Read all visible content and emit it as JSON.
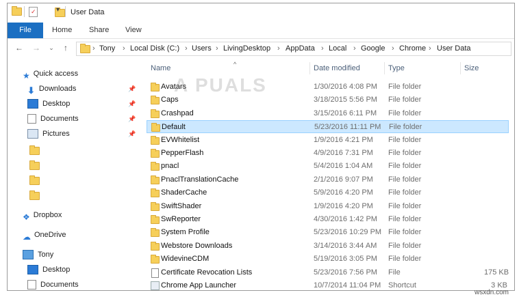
{
  "window": {
    "title": "User Data"
  },
  "ribbon": {
    "tabs": [
      "File",
      "Home",
      "Share",
      "View"
    ]
  },
  "address": {
    "crumbs": [
      "Tony",
      "Local Disk (C:)",
      "Users",
      "LivingDesktop",
      "AppData",
      "Local",
      "Google",
      "Chrome",
      "User Data"
    ]
  },
  "sidebar": {
    "quick_access": "Quick access",
    "pinned": [
      "Downloads",
      "Desktop",
      "Documents",
      "Pictures"
    ],
    "dropbox": "Dropbox",
    "onedrive": "OneDrive",
    "pc": "Tony",
    "pc_items": [
      "Desktop",
      "Documents"
    ]
  },
  "columns": {
    "name": "Name",
    "date": "Date modified",
    "type": "Type",
    "size": "Size"
  },
  "files": [
    {
      "name": "Avatars",
      "date": "1/30/2016 4:08 PM",
      "type": "File folder",
      "size": "",
      "icon": "folder"
    },
    {
      "name": "Caps",
      "date": "3/18/2015 5:56 PM",
      "type": "File folder",
      "size": "",
      "icon": "folder"
    },
    {
      "name": "Crashpad",
      "date": "3/15/2016 6:11 PM",
      "type": "File folder",
      "size": "",
      "icon": "folder"
    },
    {
      "name": "Default",
      "date": "5/23/2016 11:11 PM",
      "type": "File folder",
      "size": "",
      "icon": "folder"
    },
    {
      "name": "EVWhitelist",
      "date": "1/9/2016 4:21 PM",
      "type": "File folder",
      "size": "",
      "icon": "folder"
    },
    {
      "name": "PepperFlash",
      "date": "4/9/2016 7:31 PM",
      "type": "File folder",
      "size": "",
      "icon": "folder"
    },
    {
      "name": "pnacl",
      "date": "5/4/2016 1:04 AM",
      "type": "File folder",
      "size": "",
      "icon": "folder"
    },
    {
      "name": "PnaclTranslationCache",
      "date": "2/1/2016 9:07 PM",
      "type": "File folder",
      "size": "",
      "icon": "folder"
    },
    {
      "name": "ShaderCache",
      "date": "5/9/2016 4:20 PM",
      "type": "File folder",
      "size": "",
      "icon": "folder"
    },
    {
      "name": "SwiftShader",
      "date": "1/9/2016 4:20 PM",
      "type": "File folder",
      "size": "",
      "icon": "folder"
    },
    {
      "name": "SwReporter",
      "date": "4/30/2016 1:42 PM",
      "type": "File folder",
      "size": "",
      "icon": "folder"
    },
    {
      "name": "System Profile",
      "date": "5/23/2016 10:29 PM",
      "type": "File folder",
      "size": "",
      "icon": "folder"
    },
    {
      "name": "Webstore Downloads",
      "date": "3/14/2016 3:44 AM",
      "type": "File folder",
      "size": "",
      "icon": "folder"
    },
    {
      "name": "WidevineCDM",
      "date": "5/19/2016 3:05 PM",
      "type": "File folder",
      "size": "",
      "icon": "folder"
    },
    {
      "name": "Certificate Revocation Lists",
      "date": "5/23/2016 7:56 PM",
      "type": "File",
      "size": "175 KB",
      "icon": "file"
    },
    {
      "name": "Chrome App Launcher",
      "date": "10/7/2014 11:04 PM",
      "type": "Shortcut",
      "size": "3 KB",
      "icon": "shortcut"
    }
  ],
  "watermark": "A PUALS",
  "site": "wsxdn.com"
}
